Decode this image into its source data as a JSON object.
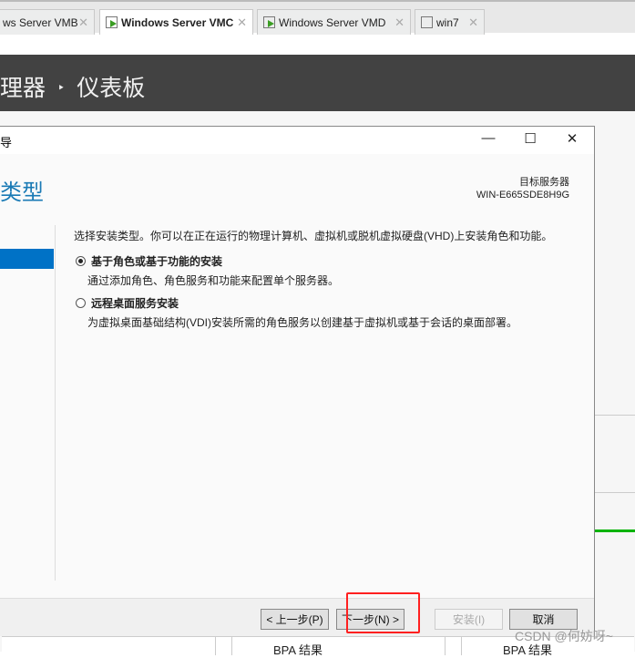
{
  "tabs": [
    {
      "label": "ws Server VMB",
      "active": false,
      "running": false
    },
    {
      "label": "Windows Server VMC",
      "active": true,
      "running": true
    },
    {
      "label": "Windows Server VMD",
      "active": false,
      "running": true
    },
    {
      "label": "win7",
      "active": false,
      "running": false
    }
  ],
  "header": {
    "prefix": "理器",
    "separator": "‣",
    "title": "仪表板"
  },
  "dialog": {
    "title": "导",
    "page_title": "类型",
    "target_label": "目标服务器",
    "target_server": "WIN-E665SDE8H9G",
    "description": "选择安装类型。你可以在正在运行的物理计算机、虚拟机或脱机虚拟硬盘(VHD)上安装角色和功能。",
    "options": [
      {
        "label": "基于角色或基于功能的安装",
        "desc": "通过添加角色、角色服务和功能来配置单个服务器。",
        "selected": true
      },
      {
        "label": "远程桌面服务安装",
        "desc": "为虚拟桌面基础结构(VDI)安装所需的角色服务以创建基于虚拟机或基于会话的桌面部署。",
        "selected": false
      }
    ],
    "buttons": {
      "prev": "< 上一步(P)",
      "next": "下一步(N) >",
      "install": "安装(I)",
      "cancel": "取消"
    }
  },
  "bottom": {
    "bpa1": "BPA 结果",
    "bpa2": "BPA 结果"
  },
  "watermark": "CSDN @何妨呀~",
  "colors": {
    "accent": "#0072c6",
    "highlight": "#ff2020",
    "status_green": "#00b300"
  }
}
